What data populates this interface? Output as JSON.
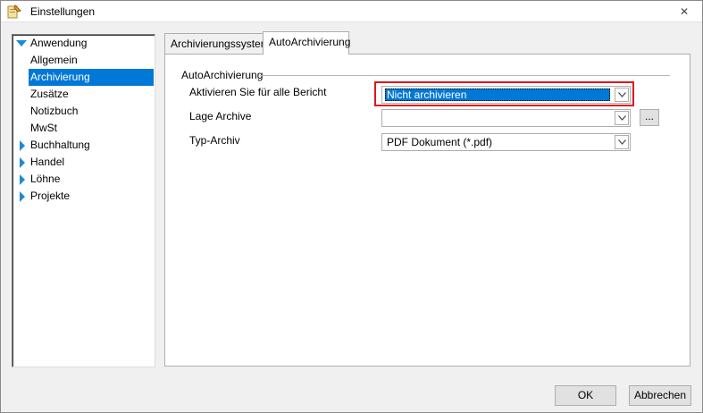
{
  "window": {
    "title": "Einstellungen",
    "close_label": "✕"
  },
  "tree": {
    "items": [
      {
        "label": "Anwendung",
        "expanded": true
      },
      {
        "label": "Allgemein"
      },
      {
        "label": "Archivierung",
        "selected": true
      },
      {
        "label": "Zusätze"
      },
      {
        "label": "Notizbuch"
      },
      {
        "label": "MwSt"
      },
      {
        "label": "Buchhaltung",
        "expanded": false
      },
      {
        "label": "Handel",
        "expanded": false
      },
      {
        "label": "Löhne",
        "expanded": false
      },
      {
        "label": "Projekte",
        "expanded": false
      }
    ]
  },
  "tabs": [
    {
      "label": "Archivierungssystem",
      "active": false
    },
    {
      "label": "AutoArchivierung",
      "active": true
    }
  ],
  "panel": {
    "group_title": "AutoArchivierung",
    "fields": [
      {
        "label": "Aktivieren Sie für alle Bericht",
        "value": "Nicht archivieren"
      },
      {
        "label": "Lage Archive",
        "value": ""
      },
      {
        "label": "Typ-Archiv",
        "value": "PDF Dokument (*.pdf)"
      }
    ],
    "browse_label": "..."
  },
  "buttons": {
    "ok": "OK",
    "cancel": "Abbrechen"
  },
  "colors": {
    "selection": "#0078d7",
    "highlight_border": "#e2141c",
    "tree_arrow": "#1c8ad8"
  }
}
